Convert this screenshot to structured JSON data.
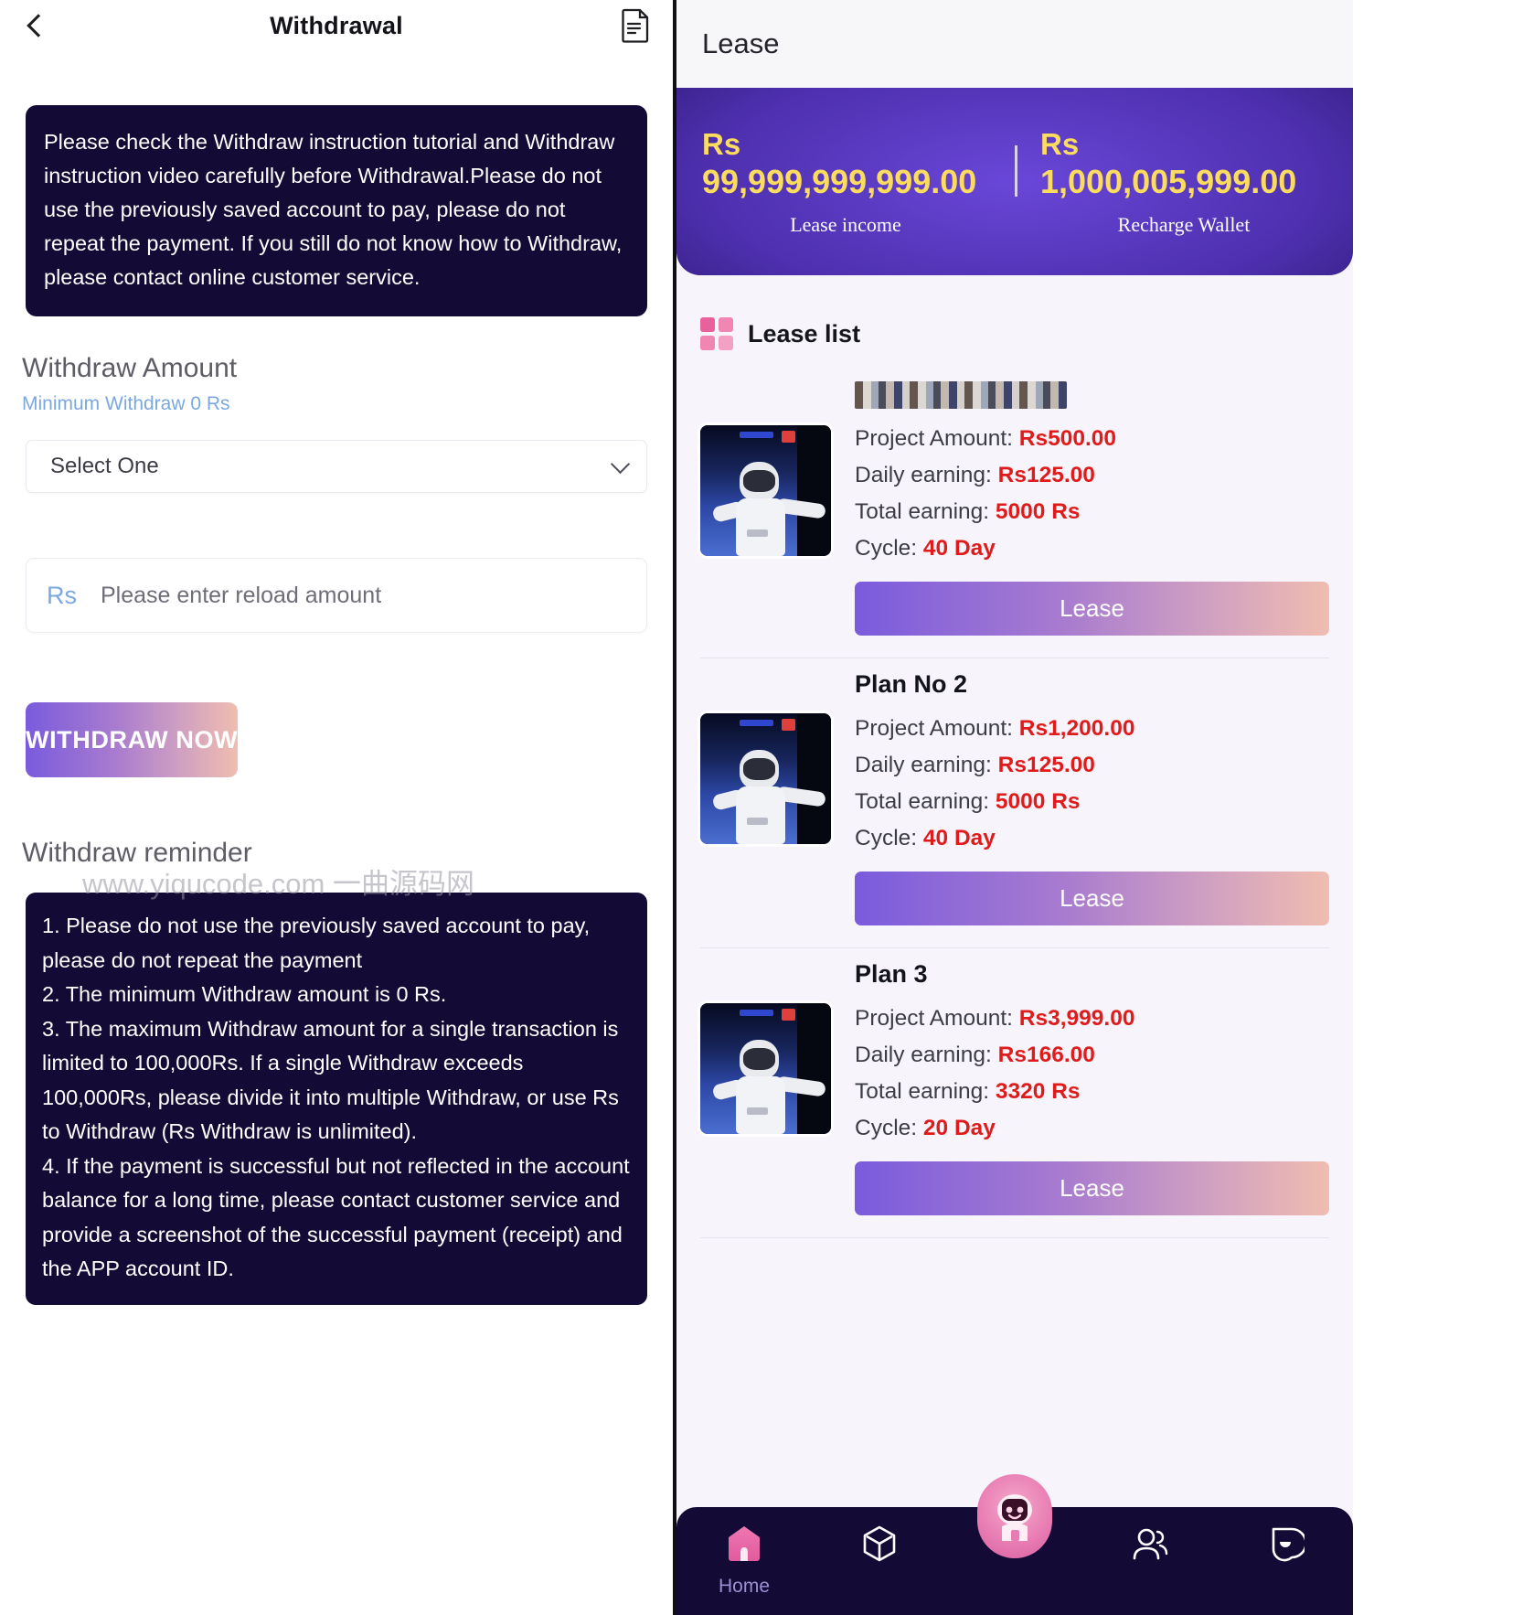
{
  "left": {
    "header": {
      "title": "Withdrawal",
      "back_icon": "chevron-left-icon",
      "doc_icon": "document-icon"
    },
    "notice": "Please check the Withdraw instruction tutorial and Withdraw instruction video carefully before Withdrawal.Please do not use the previously saved account to pay, please do not repeat the payment. If you still do not know how to Withdraw, please contact online customer service.",
    "amount_section": {
      "title": "Withdraw Amount",
      "minimum": "Minimum Withdraw 0 Rs",
      "select_value": "Select One",
      "select_options": [
        "Select One"
      ],
      "currency_prefix": "Rs",
      "amount_placeholder": "Please enter reload amount",
      "amount_value": ""
    },
    "submit_label": "WITHDRAW NOW",
    "reminder": {
      "title": "Withdraw reminder",
      "watermark": "www.yiqucode.com 一曲源码网",
      "items": [
        "1. Please do not use the previously saved account to pay, please do not repeat the payment",
        "2. The minimum Withdraw amount is 0 Rs.",
        "3. The maximum Withdraw amount for a single transaction is limited to 100,000Rs. If a single Withdraw exceeds 100,000Rs, please divide it into multiple Withdraw, or use Rs to Withdraw (Rs Withdraw is unlimited).",
        "4. If the payment is successful but not reflected in the account balance for a long time, please contact customer service and provide a screenshot of the successful payment (receipt) and the APP account ID."
      ]
    }
  },
  "right": {
    "header": {
      "title": "Lease"
    },
    "balance": {
      "lease_income": {
        "currency": "Rs",
        "amount": "99,999,999,999.00",
        "label": "Lease income"
      },
      "recharge_wallet": {
        "currency": "Rs",
        "amount": "1,000,005,999.00",
        "label": "Recharge Wallet"
      }
    },
    "lease_list": {
      "icon": "grid-squares-icon",
      "label": "Lease list",
      "field_labels": {
        "project_amount": "Project Amount:",
        "daily_earning": "Daily earning:",
        "total_earning": "Total earning:",
        "cycle": "Cycle:"
      },
      "items": [
        {
          "name": "",
          "redacted": true,
          "project_amount": "Rs500.00",
          "daily_earning": "Rs125.00",
          "total_earning": "5000 Rs",
          "cycle": "40 Day",
          "button": "Lease"
        },
        {
          "name": "Plan No 2",
          "redacted": false,
          "project_amount": "Rs1,200.00",
          "daily_earning": "Rs125.00",
          "total_earning": "5000 Rs",
          "cycle": "40 Day",
          "button": "Lease"
        },
        {
          "name": "Plan 3",
          "redacted": false,
          "project_amount": "Rs3,999.00",
          "daily_earning": "Rs166.00",
          "total_earning": "3320 Rs",
          "cycle": "20 Day",
          "button": "Lease"
        }
      ]
    },
    "bottom_nav": {
      "items": [
        {
          "icon": "home-icon",
          "label": "Home",
          "active": true
        },
        {
          "icon": "cube-box-icon",
          "label": "",
          "active": false
        },
        {
          "icon": "robot-assistant-icon",
          "label": "",
          "active": false
        },
        {
          "icon": "users-icon",
          "label": "",
          "active": false
        },
        {
          "icon": "chat-smile-icon",
          "label": "",
          "active": false
        }
      ]
    }
  },
  "colors": {
    "dark_navy": "#130a36",
    "accent_purple": "#7a5bdd",
    "accent_pink": "#f0bdb0",
    "gold": "#fbdc5f",
    "red": "#e01b1b",
    "link_blue": "#7aa8e0"
  }
}
